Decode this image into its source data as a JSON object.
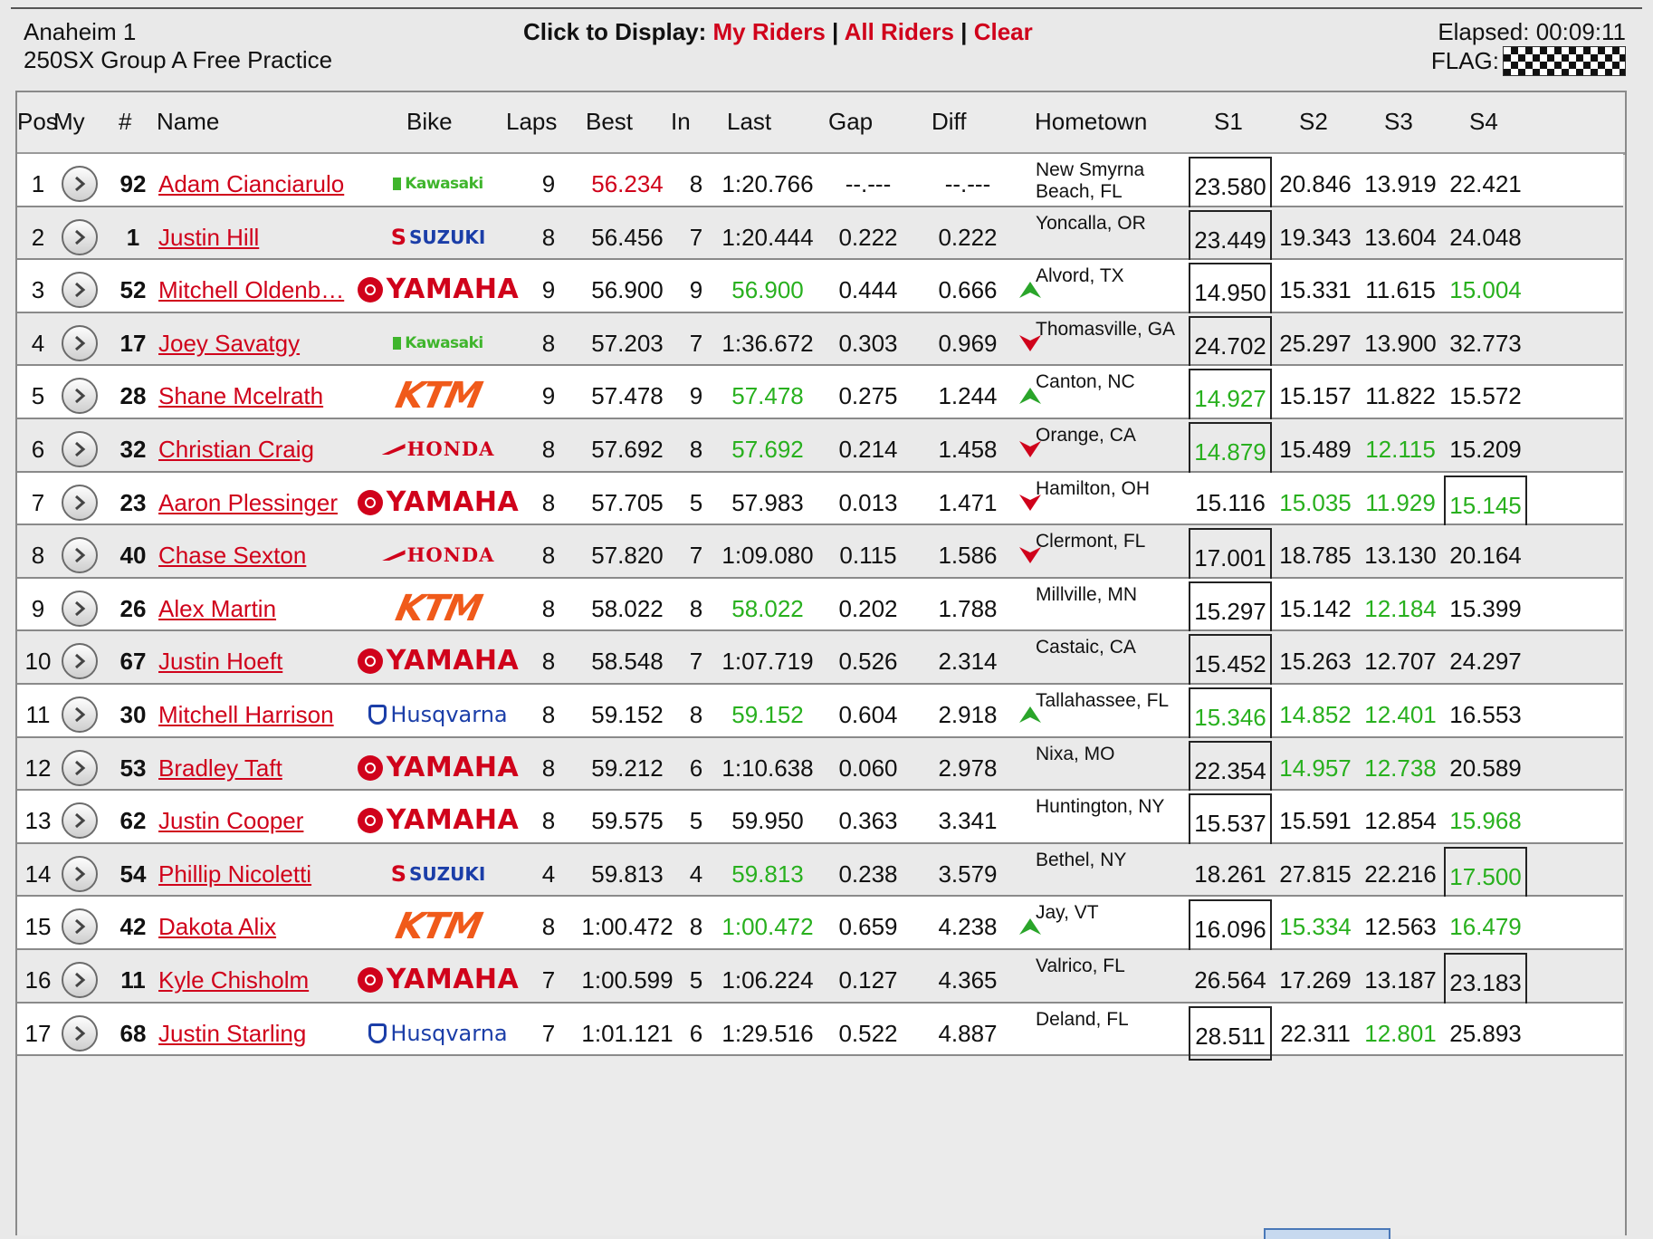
{
  "header": {
    "event": "Anaheim 1",
    "session": "250SX Group A Free Practice",
    "display_prompt": "Click to Display:",
    "link_my_riders": "My Riders",
    "link_all_riders": "All Riders",
    "link_clear": "Clear",
    "separator": "|",
    "elapsed": "Elapsed: 00:09:11",
    "flag_label": "FLAG:",
    "flag_icon": "checkered-flag-icon"
  },
  "columns": {
    "pos": "Pos",
    "my": "My",
    "num": "#",
    "name": "Name",
    "bike": "Bike",
    "laps": "Laps",
    "best": "Best",
    "in": "In",
    "last": "Last",
    "gap": "Gap",
    "diff": "Diff",
    "hometown": "Hometown",
    "s1": "S1",
    "s2": "S2",
    "s3": "S3",
    "s4": "S4"
  },
  "colors": {
    "link_red": "#d0021b",
    "best_green": "#28b01e",
    "trend_green": "#2aa52a",
    "trend_red": "#d0021b"
  },
  "rows": [
    {
      "pos": "1",
      "num": "92",
      "name": "Adam Cianciarulo",
      "bike": "Kawasaki",
      "laps": "9",
      "best": "56.234",
      "in": "8",
      "last": "1:20.766",
      "gap": "--.---",
      "diff": "--.---",
      "trend": "",
      "hometown": "New Smyrna Beach, FL",
      "s1": "23.580",
      "s2": "20.846",
      "s3": "13.919",
      "s4": "22.421",
      "best_red": true,
      "box": 1
    },
    {
      "pos": "2",
      "num": "1",
      "name": "Justin Hill",
      "bike": "SUZUKI",
      "laps": "8",
      "best": "56.456",
      "in": "7",
      "last": "1:20.444",
      "gap": "0.222",
      "diff": "0.222",
      "trend": "",
      "hometown": "Yoncalla, OR",
      "s1": "23.449",
      "s2": "19.343",
      "s3": "13.604",
      "s4": "24.048",
      "box": 1
    },
    {
      "pos": "3",
      "num": "52",
      "name": "Mitchell Oldenb…",
      "bike": "YAMAHA",
      "laps": "9",
      "best": "56.900",
      "in": "9",
      "last": "56.900",
      "gap": "0.444",
      "diff": "0.666",
      "trend": "up",
      "hometown": "Alvord, TX",
      "s1": "14.950",
      "s2": "15.331",
      "s3": "11.615",
      "s4": "15.004",
      "last_green": true,
      "green": [
        "s4"
      ],
      "box": 1
    },
    {
      "pos": "4",
      "num": "17",
      "name": "Joey Savatgy",
      "bike": "Kawasaki",
      "laps": "8",
      "best": "57.203",
      "in": "7",
      "last": "1:36.672",
      "gap": "0.303",
      "diff": "0.969",
      "trend": "down",
      "hometown": "Thomasville, GA",
      "s1": "24.702",
      "s2": "25.297",
      "s3": "13.900",
      "s4": "32.773",
      "box": 1
    },
    {
      "pos": "5",
      "num": "28",
      "name": "Shane Mcelrath",
      "bike": "KTM",
      "laps": "9",
      "best": "57.478",
      "in": "9",
      "last": "57.478",
      "gap": "0.275",
      "diff": "1.244",
      "trend": "up",
      "hometown": "Canton, NC",
      "s1": "14.927",
      "s2": "15.157",
      "s3": "11.822",
      "s4": "15.572",
      "last_green": true,
      "green": [
        "s1"
      ],
      "box": 1
    },
    {
      "pos": "6",
      "num": "32",
      "name": "Christian Craig",
      "bike": "HONDA",
      "laps": "8",
      "best": "57.692",
      "in": "8",
      "last": "57.692",
      "gap": "0.214",
      "diff": "1.458",
      "trend": "down",
      "hometown": "Orange, CA",
      "s1": "14.879",
      "s2": "15.489",
      "s3": "12.115",
      "s4": "15.209",
      "last_green": true,
      "green": [
        "s1",
        "s3"
      ],
      "box": 1
    },
    {
      "pos": "7",
      "num": "23",
      "name": "Aaron Plessinger",
      "bike": "YAMAHA",
      "laps": "8",
      "best": "57.705",
      "in": "5",
      "last": "57.983",
      "gap": "0.013",
      "diff": "1.471",
      "trend": "down",
      "hometown": "Hamilton, OH",
      "s1": "15.116",
      "s2": "15.035",
      "s3": "11.929",
      "s4": "15.145",
      "green": [
        "s2",
        "s3",
        "s4"
      ],
      "box": 4
    },
    {
      "pos": "8",
      "num": "40",
      "name": "Chase Sexton",
      "bike": "HONDA",
      "laps": "8",
      "best": "57.820",
      "in": "7",
      "last": "1:09.080",
      "gap": "0.115",
      "diff": "1.586",
      "trend": "down",
      "hometown": "Clermont, FL",
      "s1": "17.001",
      "s2": "18.785",
      "s3": "13.130",
      "s4": "20.164",
      "box": 1
    },
    {
      "pos": "9",
      "num": "26",
      "name": "Alex Martin",
      "bike": "KTM",
      "laps": "8",
      "best": "58.022",
      "in": "8",
      "last": "58.022",
      "gap": "0.202",
      "diff": "1.788",
      "trend": "",
      "hometown": "Millville, MN",
      "s1": "15.297",
      "s2": "15.142",
      "s3": "12.184",
      "s4": "15.399",
      "last_green": true,
      "green": [
        "s3"
      ],
      "box": 1
    },
    {
      "pos": "10",
      "num": "67",
      "name": "Justin Hoeft",
      "bike": "YAMAHA",
      "laps": "8",
      "best": "58.548",
      "in": "7",
      "last": "1:07.719",
      "gap": "0.526",
      "diff": "2.314",
      "trend": "",
      "hometown": "Castaic, CA",
      "s1": "15.452",
      "s2": "15.263",
      "s3": "12.707",
      "s4": "24.297",
      "box": 1
    },
    {
      "pos": "11",
      "num": "30",
      "name": "Mitchell Harrison",
      "bike": "Husqvarna",
      "laps": "8",
      "best": "59.152",
      "in": "8",
      "last": "59.152",
      "gap": "0.604",
      "diff": "2.918",
      "trend": "up",
      "hometown": "Tallahassee, FL",
      "s1": "15.346",
      "s2": "14.852",
      "s3": "12.401",
      "s4": "16.553",
      "last_green": true,
      "green": [
        "s1",
        "s2",
        "s3"
      ],
      "box": 1
    },
    {
      "pos": "12",
      "num": "53",
      "name": "Bradley Taft",
      "bike": "YAMAHA",
      "laps": "8",
      "best": "59.212",
      "in": "6",
      "last": "1:10.638",
      "gap": "0.060",
      "diff": "2.978",
      "trend": "",
      "hometown": "Nixa, MO",
      "s1": "22.354",
      "s2": "14.957",
      "s3": "12.738",
      "s4": "20.589",
      "green": [
        "s2",
        "s3"
      ],
      "box": 1
    },
    {
      "pos": "13",
      "num": "62",
      "name": "Justin Cooper",
      "bike": "YAMAHA",
      "laps": "8",
      "best": "59.575",
      "in": "5",
      "last": "59.950",
      "gap": "0.363",
      "diff": "3.341",
      "trend": "",
      "hometown": "Huntington, NY",
      "s1": "15.537",
      "s2": "15.591",
      "s3": "12.854",
      "s4": "15.968",
      "green": [
        "s4"
      ],
      "box": 1
    },
    {
      "pos": "14",
      "num": "54",
      "name": "Phillip Nicoletti",
      "bike": "SUZUKI",
      "laps": "4",
      "best": "59.813",
      "in": "4",
      "last": "59.813",
      "gap": "0.238",
      "diff": "3.579",
      "trend": "",
      "hometown": "Bethel, NY",
      "s1": "18.261",
      "s2": "27.815",
      "s3": "22.216",
      "s4": "17.500",
      "last_green": true,
      "green": [
        "s4"
      ],
      "box": 4
    },
    {
      "pos": "15",
      "num": "42",
      "name": "Dakota Alix",
      "bike": "KTM",
      "laps": "8",
      "best": "1:00.472",
      "in": "8",
      "last": "1:00.472",
      "gap": "0.659",
      "diff": "4.238",
      "trend": "up",
      "hometown": "Jay, VT",
      "s1": "16.096",
      "s2": "15.334",
      "s3": "12.563",
      "s4": "16.479",
      "last_green": true,
      "green": [
        "s2",
        "s4"
      ],
      "box": 1
    },
    {
      "pos": "16",
      "num": "11",
      "name": "Kyle Chisholm",
      "bike": "YAMAHA",
      "laps": "7",
      "best": "1:00.599",
      "in": "5",
      "last": "1:06.224",
      "gap": "0.127",
      "diff": "4.365",
      "trend": "",
      "hometown": "Valrico, FL",
      "s1": "26.564",
      "s2": "17.269",
      "s3": "13.187",
      "s4": "23.183",
      "box": 4
    },
    {
      "pos": "17",
      "num": "68",
      "name": "Justin Starling",
      "bike": "Husqvarna",
      "laps": "7",
      "best": "1:01.121",
      "in": "6",
      "last": "1:29.516",
      "gap": "0.522",
      "diff": "4.887",
      "trend": "",
      "hometown": "Deland, FL",
      "s1": "28.511",
      "s2": "22.311",
      "s3": "12.801",
      "s4": "25.893",
      "green": [
        "s3"
      ],
      "box": 1
    }
  ]
}
